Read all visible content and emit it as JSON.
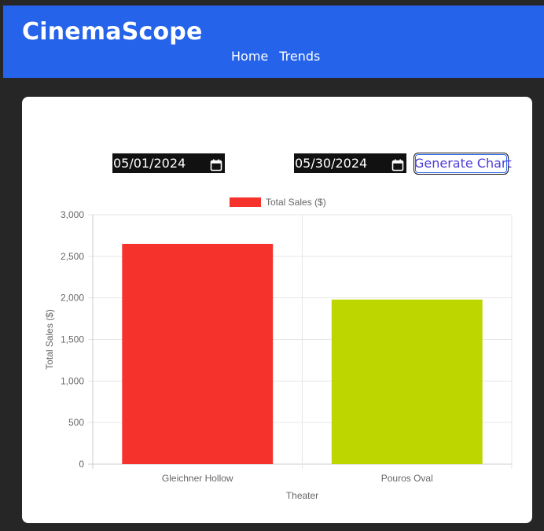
{
  "app": {
    "brand": "CinemaScope",
    "nav": [
      {
        "label": "Home"
      },
      {
        "label": "Trends"
      }
    ]
  },
  "controls": {
    "start_date": "05/01/2024",
    "end_date": "05/30/2024",
    "generate_label": "Generate Chart"
  },
  "chart_data": {
    "type": "bar",
    "categories": [
      "Gleichner Hollow",
      "Pouros Oval"
    ],
    "series": [
      {
        "name": "Total Sales ($)",
        "values": [
          2650,
          1980
        ],
        "colors": [
          "#f6322d",
          "#bdd600"
        ]
      }
    ],
    "legend_color": "#f6322d",
    "xlabel": "Theater",
    "ylabel": "Total Sales ($)",
    "ylim": [
      0,
      3000
    ],
    "yticks": [
      "0",
      "500",
      "1,000",
      "1,500",
      "2,000",
      "2,500",
      "3,000"
    ],
    "ytick_values": [
      0,
      500,
      1000,
      1500,
      2000,
      2500,
      3000
    ],
    "grid": true,
    "legend_position": "top"
  }
}
